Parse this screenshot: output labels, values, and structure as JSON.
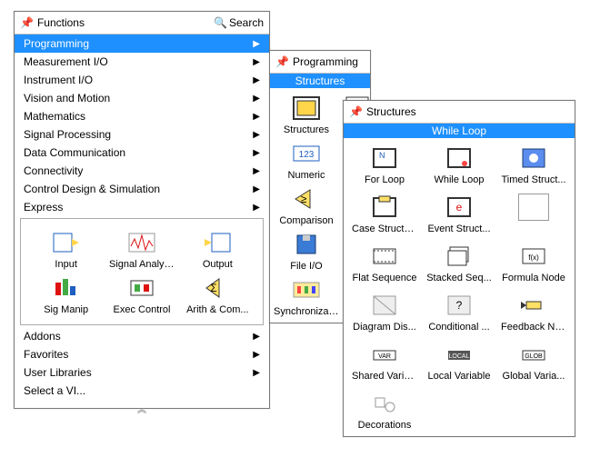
{
  "p1": {
    "title": "Functions",
    "search": "Search",
    "items": [
      {
        "label": "Programming",
        "sel": true,
        "arrow": true
      },
      {
        "label": "Measurement I/O",
        "arrow": true
      },
      {
        "label": "Instrument I/O",
        "arrow": true
      },
      {
        "label": "Vision and Motion",
        "arrow": true
      },
      {
        "label": "Mathematics",
        "arrow": true
      },
      {
        "label": "Signal Processing",
        "arrow": true
      },
      {
        "label": "Data Communication",
        "arrow": true
      },
      {
        "label": "Connectivity",
        "arrow": true
      },
      {
        "label": "Control Design & Simulation",
        "arrow": true
      },
      {
        "label": "Express",
        "arrow": true
      }
    ],
    "express_tiles": [
      {
        "label": "Input"
      },
      {
        "label": "Signal Analysis"
      },
      {
        "label": "Output"
      },
      {
        "label": "Sig Manip"
      },
      {
        "label": "Exec Control"
      },
      {
        "label": "Arith & Com..."
      }
    ],
    "footer": [
      {
        "label": "Addons",
        "arrow": true
      },
      {
        "label": "Favorites",
        "arrow": true
      },
      {
        "label": "User Libraries",
        "arrow": true
      },
      {
        "label": "Select a VI..."
      }
    ]
  },
  "p2": {
    "title": "Programming",
    "bluebar": "Structures",
    "tiles": [
      {
        "label": "Structures"
      },
      {
        "label": "Numeric"
      },
      {
        "label": "Comparison"
      },
      {
        "label": "File I/O"
      },
      {
        "label": "Synchronizat..."
      }
    ],
    "extra_icons": [
      "array-icon",
      "cluster-icon"
    ]
  },
  "p3": {
    "title": "Structures",
    "bluebar": "While Loop",
    "tiles": [
      {
        "label": "For Loop"
      },
      {
        "label": "While Loop",
        "sel": true
      },
      {
        "label": "Timed Struct..."
      },
      {
        "label": "Case Structure"
      },
      {
        "label": "Event Struct..."
      },
      {
        "label": ""
      },
      {
        "label": "Flat Sequence"
      },
      {
        "label": "Stacked Seq..."
      },
      {
        "label": "Formula Node"
      },
      {
        "label": "Diagram Dis..."
      },
      {
        "label": "Conditional ..."
      },
      {
        "label": "Feedback No..."
      },
      {
        "label": "Shared Varia..."
      },
      {
        "label": "Local Variable"
      },
      {
        "label": "Global Varia..."
      },
      {
        "label": "Decorations"
      }
    ]
  }
}
